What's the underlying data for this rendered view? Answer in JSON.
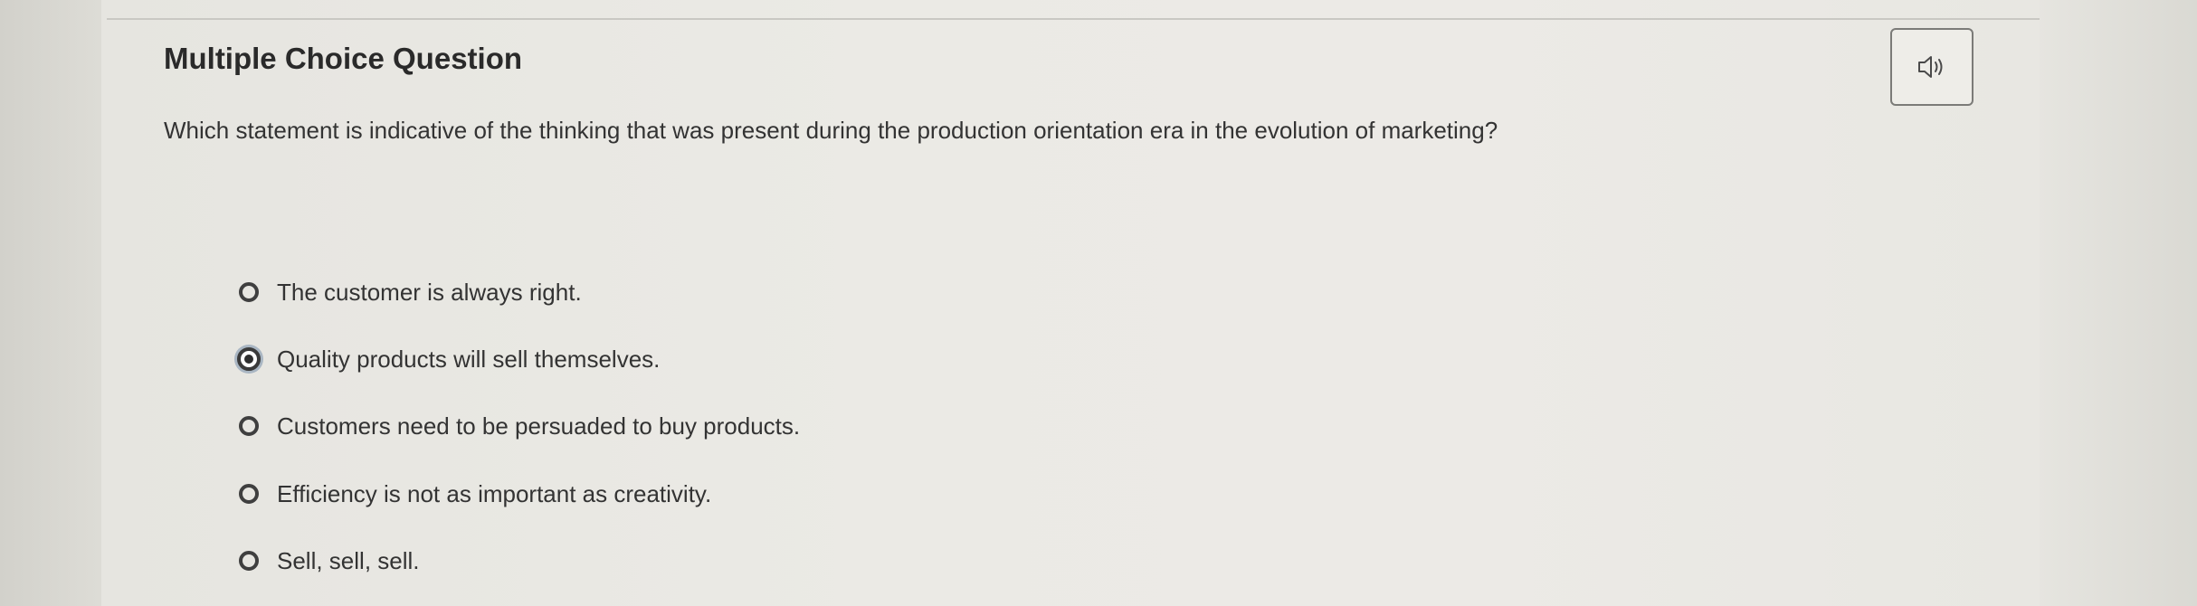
{
  "question": {
    "heading": "Multiple Choice Question",
    "prompt": "Which statement is indicative of the thinking that was present during the production orientation era in the evolution of marketing?",
    "audio_icon": "speaker-icon",
    "options": [
      {
        "label": "The customer is always right.",
        "selected": false
      },
      {
        "label": "Quality products will sell themselves.",
        "selected": true
      },
      {
        "label": "Customers need to be persuaded to buy products.",
        "selected": false
      },
      {
        "label": "Efficiency is not as important as creativity.",
        "selected": false
      },
      {
        "label": "Sell, sell, sell.",
        "selected": false
      }
    ]
  },
  "colors": {
    "text": "#333333",
    "radio_border": "#3f3f3f",
    "selected_focus_ring": "#a9b6c3",
    "button_border": "#7b7b78"
  }
}
